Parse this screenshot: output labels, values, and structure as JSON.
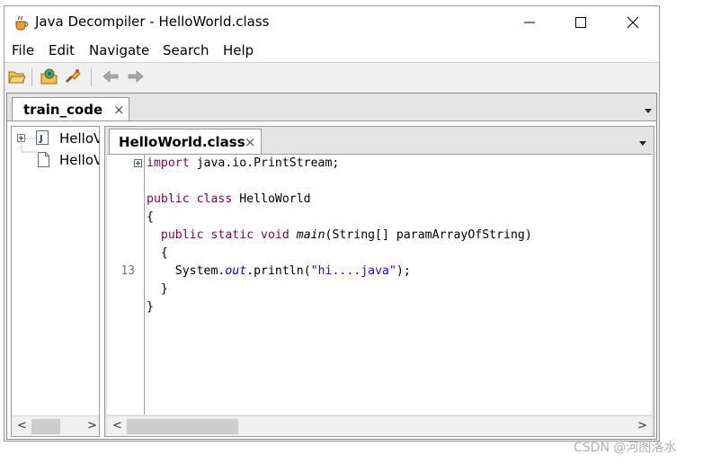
{
  "window": {
    "title": "Java Decompiler - HelloWorld.class",
    "icons": {
      "app": "coffee-cup-icon",
      "minimize": "minimize-icon",
      "maximize": "maximize-icon",
      "close": "close-icon"
    }
  },
  "menu": {
    "file": "File",
    "edit": "Edit",
    "navigate": "Navigate",
    "search": "Search",
    "help": "Help"
  },
  "toolbar": {
    "icons": [
      "open-file-icon",
      "open-type-icon",
      "search-icon",
      "back-icon",
      "forward-icon"
    ]
  },
  "outer_tab": {
    "label": "train_code",
    "close": "×"
  },
  "tree": {
    "items": [
      {
        "label": "HelloWorld.class",
        "icon": "java-class-icon",
        "expandable": true
      },
      {
        "label": "HelloWorld.java",
        "icon": "file-icon",
        "expandable": false
      }
    ],
    "visible_labels": [
      "HelloV",
      "HelloV"
    ]
  },
  "editor_tab": {
    "label": "HelloWorld.class",
    "close": "×"
  },
  "code": {
    "lines": [
      {
        "num": "",
        "parts": [
          [
            "kw",
            "import"
          ],
          [
            "",
            " java.io.PrintStream;"
          ]
        ],
        "fold": true
      },
      {
        "num": "",
        "parts": []
      },
      {
        "num": "",
        "parts": [
          [
            "kw",
            "public class"
          ],
          [
            "",
            " HelloWorld"
          ]
        ]
      },
      {
        "num": "",
        "parts": [
          [
            "",
            "{"
          ]
        ]
      },
      {
        "num": "",
        "parts": [
          [
            "",
            "  "
          ],
          [
            "kw",
            "public static void"
          ],
          [
            "",
            " "
          ],
          [
            "ital-plain",
            "main"
          ],
          [
            "",
            "(String[] paramArrayOfString)"
          ]
        ]
      },
      {
        "num": "",
        "parts": [
          [
            "",
            "  {"
          ]
        ]
      },
      {
        "num": "13",
        "parts": [
          [
            "",
            "    System."
          ],
          [
            "ital",
            "out"
          ],
          [
            "",
            ".println("
          ],
          [
            "str",
            "\"hi....java\""
          ],
          [
            "",
            ");"
          ]
        ]
      },
      {
        "num": "",
        "parts": [
          [
            "",
            "  }"
          ]
        ]
      },
      {
        "num": "",
        "parts": [
          [
            "",
            "}"
          ]
        ]
      }
    ]
  },
  "scroll": {
    "left": "<",
    "right": ">"
  },
  "watermark": "CSDN @河图洛水",
  "colors": {
    "keyword": "#7f0055",
    "string": "#2a00ff",
    "field": "#0000c0"
  }
}
